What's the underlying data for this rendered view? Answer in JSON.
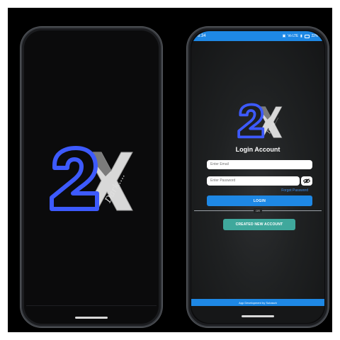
{
  "splash": {
    "logo_mark": "2X",
    "logo_script": "Dark...."
  },
  "login": {
    "status": {
      "time": "8:34",
      "icons": [
        "sim-icon",
        "wifi-icon",
        "signal-icon",
        "battery-icon"
      ],
      "status_text": "Vo LTE",
      "battery": "22%"
    },
    "logo_mark": "2X",
    "logo_script": "Dark....",
    "title": "Login Account",
    "email_placeholder": "Enter Email",
    "password_placeholder": "Enter Password",
    "forgot_label": "Forgot Password",
    "login_label": "LOGIN",
    "or_label": "OR",
    "create_label": "CREATED NEW ACCOUNT",
    "footer": "App Development by Subasch"
  },
  "colors": {
    "accent_blue": "#1e88e5",
    "logo_blue": "#3d5afe",
    "create_teal": "#3fa89c",
    "link_blue": "#3d8ff0"
  }
}
